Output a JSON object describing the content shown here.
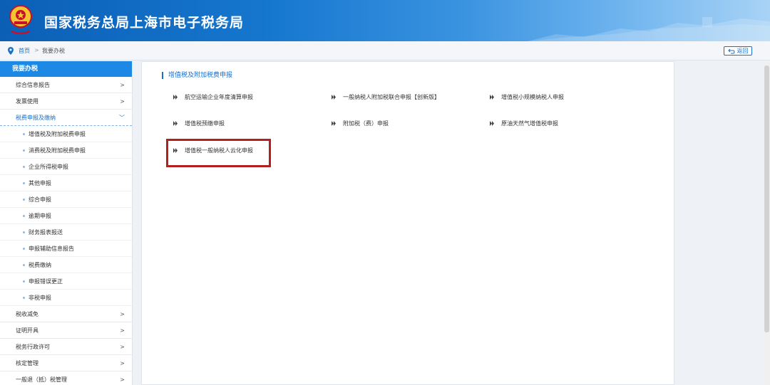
{
  "header": {
    "title": "国家税务总局上海市电子税务局"
  },
  "breadcrumb": {
    "home": "首页",
    "separator": ">",
    "current": "我要办税"
  },
  "back_button": {
    "label": "返回"
  },
  "sidebar": {
    "heading": "我要办税",
    "items_top": [
      {
        "label": "综合信息报告",
        "chevron": ">"
      },
      {
        "label": "发票使用",
        "chevron": ">"
      }
    ],
    "open_item": {
      "label": "税费申报及缴纳",
      "chevron": "﹀"
    },
    "sub_items": [
      "增值税及附加税费申报",
      "消费税及附加税费申报",
      "企业所得税申报",
      "其他申报",
      "综合申报",
      "逾期申报",
      "财务报表报送",
      "申报辅助信息报告",
      "税费缴纳",
      "申报错误更正",
      "非税申报"
    ],
    "items_bottom": [
      {
        "label": "税收减免",
        "chevron": ">"
      },
      {
        "label": "证明开具",
        "chevron": ">"
      },
      {
        "label": "税务行政许可",
        "chevron": ">"
      },
      {
        "label": "核定管理",
        "chevron": ">"
      },
      {
        "label": "一般退（抵）税管理",
        "chevron": ">"
      }
    ]
  },
  "main": {
    "section_title": "增值税及附加税费申报",
    "links": [
      "航空运输企业年度清算申报",
      "一般纳税人附加税联合申报【创新版】",
      "增值税小规模纳税人申报",
      "增值税预缴申报",
      "附加税（费）申报",
      "原油天然气增值税申报",
      "增值税一般纳税人云化申报"
    ]
  },
  "colors": {
    "primary": "#1a6fc9",
    "sidebar_head": "#1e88e5",
    "highlight": "#b4201d"
  }
}
